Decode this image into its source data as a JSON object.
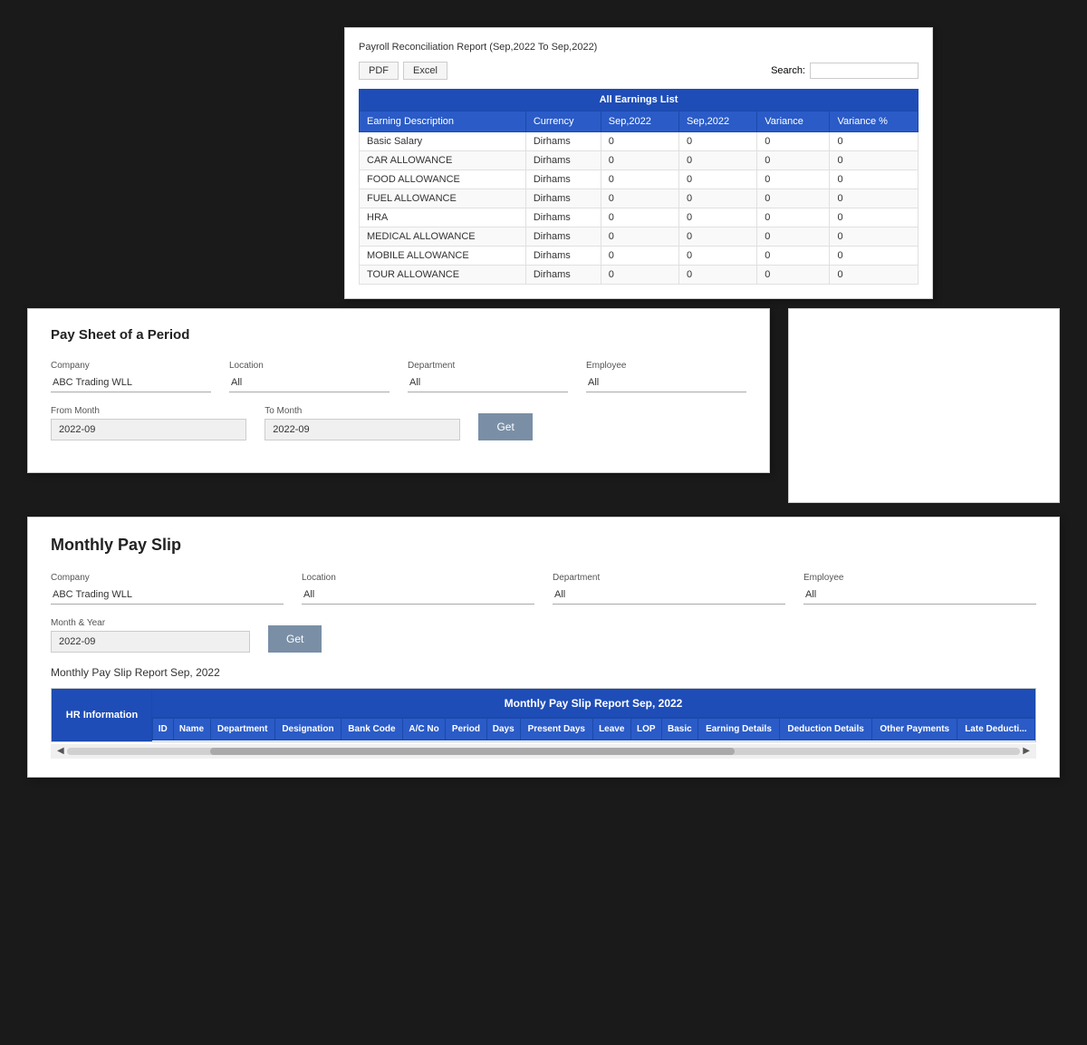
{
  "panel1": {
    "title": "Payroll Reconciliation Report (Sep,2022 To Sep,2022)",
    "buttons": {
      "pdf": "PDF",
      "excel": "Excel"
    },
    "search_label": "Search:",
    "table": {
      "header": "All Earnings List",
      "columns": [
        "Earning Description",
        "Currency",
        "Sep,2022",
        "Sep,2022",
        "Variance",
        "Variance %"
      ],
      "rows": [
        [
          "Basic Salary",
          "Dirhams",
          "0",
          "0",
          "0",
          "0"
        ],
        [
          "CAR ALLOWANCE",
          "Dirhams",
          "0",
          "0",
          "0",
          "0"
        ],
        [
          "FOOD ALLOWANCE",
          "Dirhams",
          "0",
          "0",
          "0",
          "0"
        ],
        [
          "FUEL ALLOWANCE",
          "Dirhams",
          "0",
          "0",
          "0",
          "0"
        ],
        [
          "HRA",
          "Dirhams",
          "0",
          "0",
          "0",
          "0"
        ],
        [
          "MEDICAL ALLOWANCE",
          "Dirhams",
          "0",
          "0",
          "0",
          "0"
        ],
        [
          "MOBILE ALLOWANCE",
          "Dirhams",
          "0",
          "0",
          "0",
          "0"
        ],
        [
          "TOUR ALLOWANCE",
          "Dirhams",
          "0",
          "0",
          "0",
          "0"
        ]
      ]
    }
  },
  "panel2": {
    "title": "Pay Sheet of a Period",
    "fields": {
      "company_label": "Company",
      "company_value": "ABC Trading WLL",
      "location_label": "Location",
      "location_value": "All",
      "department_label": "Department",
      "department_value": "All",
      "employee_label": "Employee",
      "employee_value": "All",
      "from_month_label": "From Month",
      "from_month_value": "2022-09",
      "to_month_label": "To Month",
      "to_month_value": "2022-09"
    },
    "get_button": "Get"
  },
  "panel3": {
    "title": "Monthly Pay Slip",
    "fields": {
      "company_label": "Company",
      "company_value": "ABC Trading WLL",
      "location_label": "Location",
      "location_value": "All",
      "department_label": "Department",
      "department_value": "All",
      "employee_label": "Employee",
      "employee_value": "All",
      "month_year_label": "Month & Year",
      "month_year_value": "2022-09"
    },
    "get_button": "Get",
    "report_section_title": "Monthly Pay Slip Report Sep, 2022",
    "table": {
      "hr_info": "HR Information",
      "monthly_title": "Monthly Pay Slip Report Sep, 2022",
      "columns": [
        "ID",
        "Name",
        "Department",
        "Designation",
        "Bank Code",
        "A/C No",
        "Period",
        "Days",
        "Present Days",
        "Leave",
        "LOP",
        "Basic",
        "Earning Details",
        "Deduction Details",
        "Other Payments",
        "Late Deducti..."
      ]
    }
  }
}
